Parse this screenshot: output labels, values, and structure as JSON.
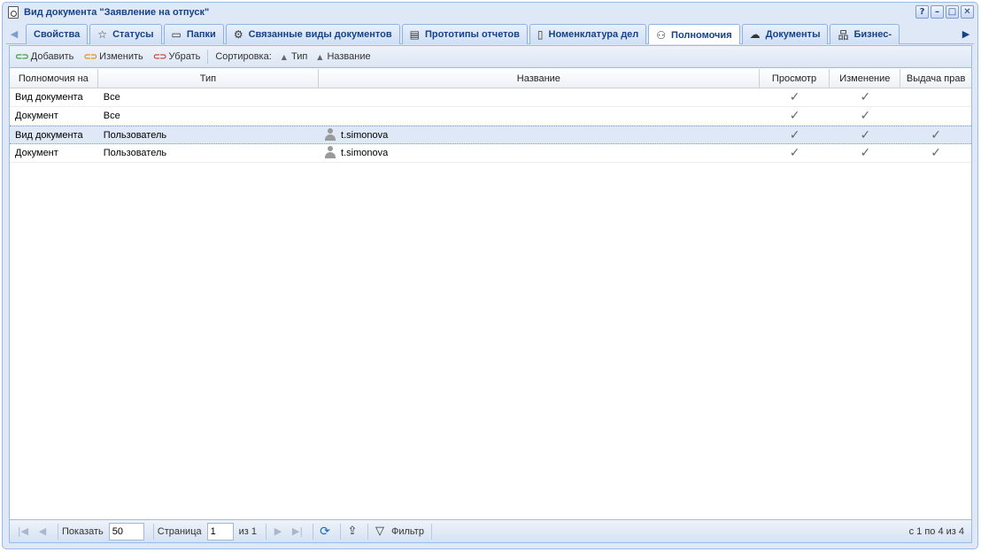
{
  "window": {
    "title": "Вид документа \"Заявление на отпуск\"",
    "tools": [
      "?",
      "–",
      "□",
      "✕"
    ]
  },
  "tabs": [
    {
      "label": "Свойства",
      "icon": ""
    },
    {
      "label": "Статусы",
      "icon": "☆"
    },
    {
      "label": "Папки",
      "icon": "▭"
    },
    {
      "label": "Связанные виды документов",
      "icon": "⚙"
    },
    {
      "label": "Прототипы отчетов",
      "icon": "▤"
    },
    {
      "label": "Номенклатура дел",
      "icon": "▯"
    },
    {
      "label": "Полномочия",
      "icon": "⚇"
    },
    {
      "label": "Документы",
      "icon": "☁"
    },
    {
      "label": "Бизнес-",
      "icon": "品"
    }
  ],
  "toolbar": {
    "add": "Добавить",
    "edit": "Изменить",
    "remove": "Убрать",
    "sort_label": "Сортировка:",
    "sort_type": "Тип",
    "sort_name": "Название"
  },
  "grid": {
    "columns": [
      "Полномочия на",
      "Тип",
      "Название",
      "Просмотр",
      "Изменение",
      "Выдача прав"
    ],
    "rows": [
      {
        "target": "Вид документа",
        "type": "Все",
        "name": "",
        "view": "✓",
        "edit": "✓",
        "grant": ""
      },
      {
        "target": "Документ",
        "type": "Все",
        "name": "",
        "view": "✓",
        "edit": "✓",
        "grant": ""
      },
      {
        "target": "Вид документа",
        "type": "Пользователь",
        "name": "t.simonova",
        "view": "✓",
        "edit": "✓",
        "grant": "✓"
      },
      {
        "target": "Документ",
        "type": "Пользователь",
        "name": "t.simonova",
        "view": "✓",
        "edit": "✓",
        "grant": "✓"
      }
    ]
  },
  "pager": {
    "show_label": "Показать",
    "page_size": "50",
    "page_label": "Страница",
    "page": "1",
    "of_label": "из 1",
    "filter_label": "Фильтр",
    "status": "с 1 по 4 из 4"
  }
}
